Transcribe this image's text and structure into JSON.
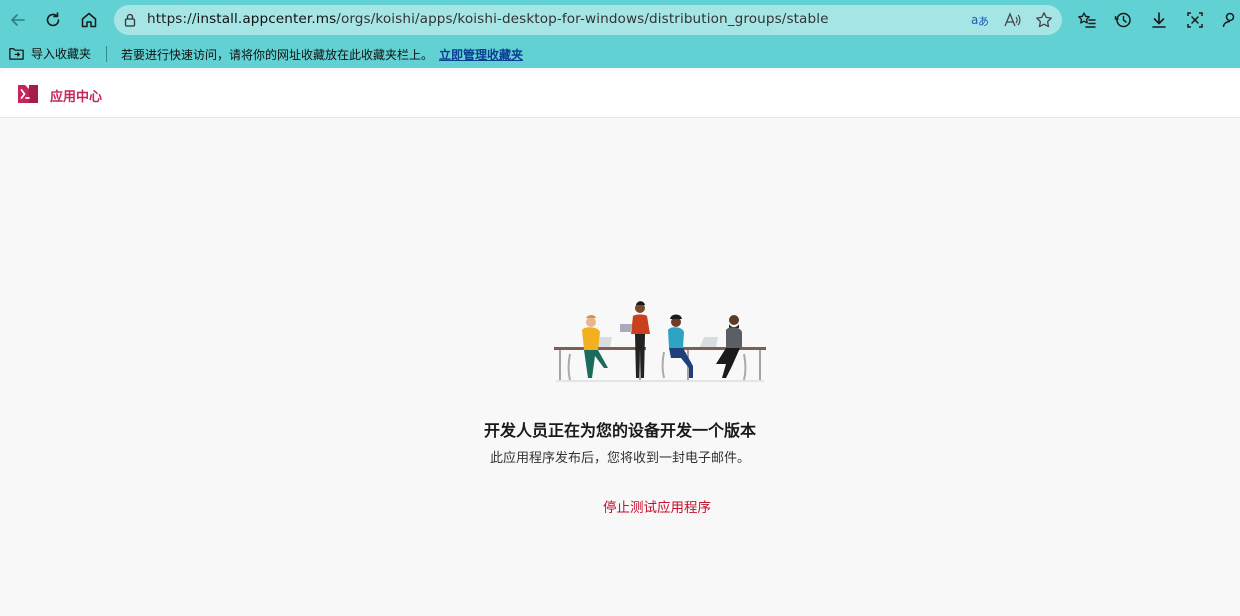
{
  "browser": {
    "url_scheme": "https://",
    "url_host": "install.appcenter.ms",
    "url_path": "/orgs/koishi/apps/koishi-desktop-for-windows/distribution_groups/stable"
  },
  "favorites_bar": {
    "import_label": "导入收藏夹",
    "message": "若要进行快速访问，请将你的网址收藏放在此收藏夹栏上。",
    "manage_link": "立即管理收藏夹"
  },
  "app_header": {
    "brand": "应用中心"
  },
  "main": {
    "headline": "开发人员正在为您的设备开发一个版本",
    "subline": "此应用程序发布后，您将收到一封电子邮件。",
    "stop_link": "停止测试应用程序"
  },
  "colors": {
    "toolbar_bg": "#62d1d3",
    "address_bg": "#a6e5e6",
    "brand": "#c4265a",
    "stop_link": "#c8102e"
  }
}
